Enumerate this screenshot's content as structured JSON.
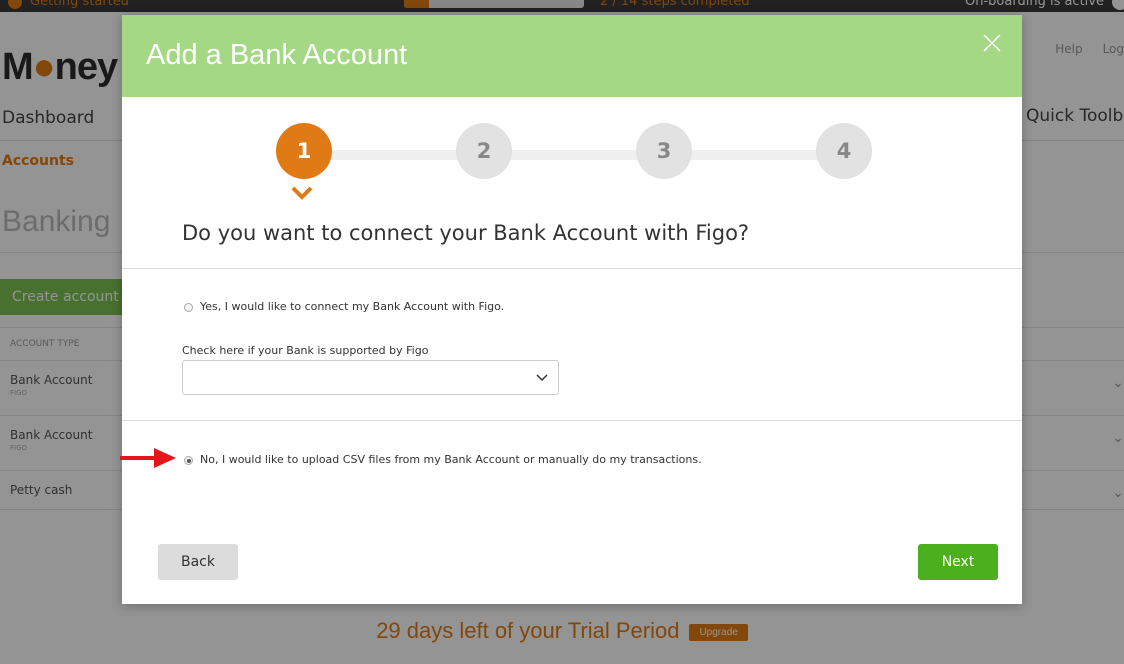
{
  "topbar": {
    "getting_started": "Getting started",
    "progress": 0.14,
    "steps_completed": "2 / 14 steps completed",
    "onboarding": "On-boarding is active"
  },
  "header": {
    "logo_left": "M",
    "logo_right": "ney",
    "help": "Help",
    "logout": "Log"
  },
  "nav": {
    "dashboard": "Dashboard",
    "quick_toolbar": "Quick Toolb"
  },
  "subnav": {
    "accounts": "Accounts"
  },
  "page": {
    "title": "Banking",
    "create_button": "Create account"
  },
  "table": {
    "header": "ACCOUNT TYPE",
    "rows": [
      {
        "name": "Bank Account",
        "sub": "FIGO"
      },
      {
        "name": "Bank Account",
        "sub": "FIGO"
      },
      {
        "name": "Petty cash",
        "sub": ""
      }
    ]
  },
  "trial": {
    "text": "29 days left of your Trial Period",
    "upgrade": "Upgrade"
  },
  "modal": {
    "title": "Add a Bank Account",
    "steps": [
      "1",
      "2",
      "3",
      "4"
    ],
    "active_step": 1,
    "question": "Do you want to connect your Bank Account with Figo?",
    "option_yes": "Yes, I would like to connect my Bank Account with Figo.",
    "check_label": "Check here if your Bank is supported by Figo",
    "select_value": "",
    "option_no": "No, I would like to upload CSV files from my Bank Account or manually do my transactions.",
    "selected_option": "no",
    "back": "Back",
    "next": "Next"
  },
  "colors": {
    "accent": "#e07a14",
    "modal_header": "#a5d884",
    "next_button": "#4caf1e",
    "arrow": "#e8141b"
  }
}
